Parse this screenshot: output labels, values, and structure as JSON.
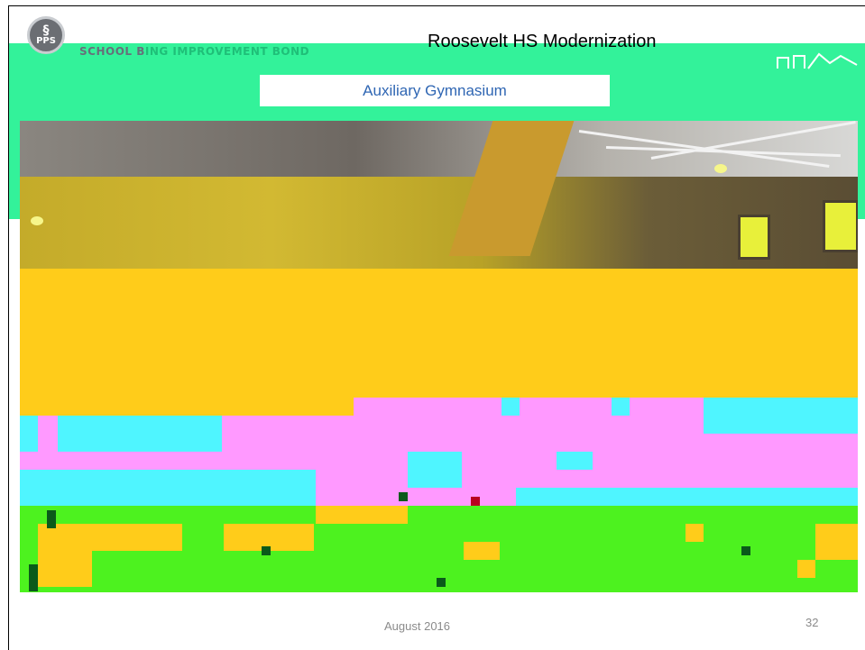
{
  "header": {
    "logo_text": "PPS",
    "bond_prefix": "SCHOOL B",
    "bond_suffix": "ING IMPROVEMENT BOND",
    "title": "Roosevelt HS Modernization"
  },
  "slide": {
    "subtitle": "Auxiliary Gymnasium",
    "photo_alt": "Auxiliary gymnasium interior photo"
  },
  "footer": {
    "date": "August 2016",
    "page_number": "32"
  },
  "colors": {
    "band": "#33f29a",
    "subtitle_text": "#2f66b3",
    "footer_text": "#8b8b8b"
  },
  "icons": [
    "pps-logo-icon",
    "roof-outline-icon"
  ]
}
